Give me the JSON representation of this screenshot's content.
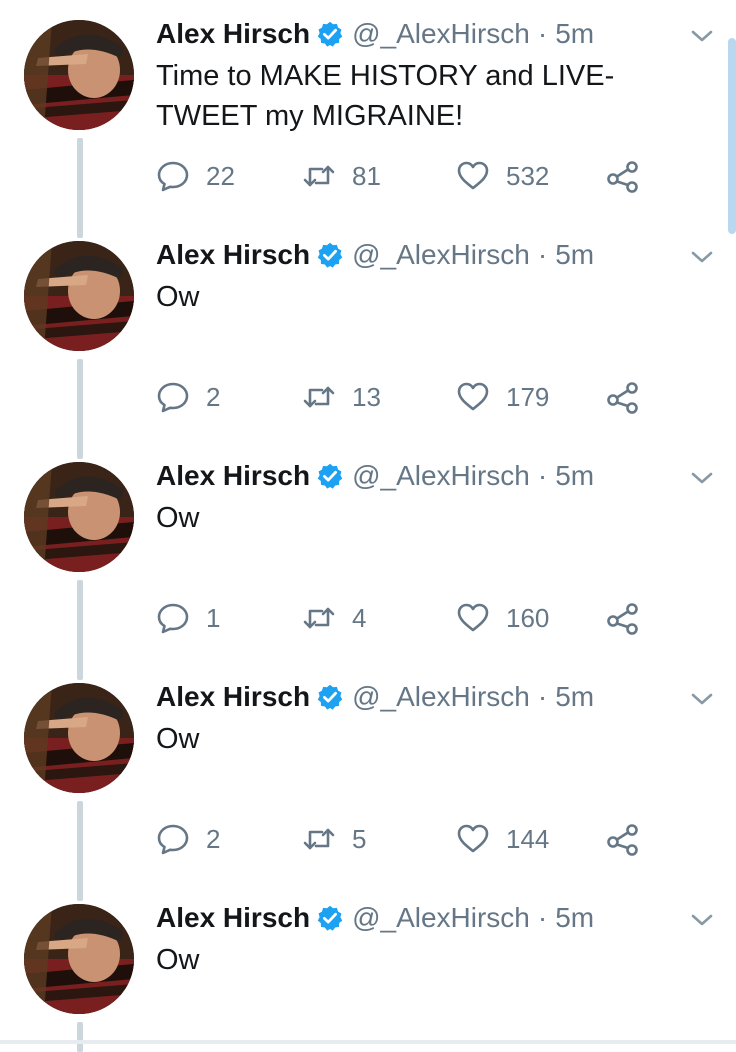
{
  "colors": {
    "text": "#14171a",
    "secondary": "#657786",
    "verified": "#1da1f2",
    "thread_line": "#ccd6dd",
    "scrollbar": "#b9d8ef"
  },
  "tweets": [
    {
      "name": "Alex Hirsch",
      "handle": "@_AlexHirsch",
      "dot": "·",
      "time": "5m",
      "text": "Time to MAKE HISTORY and LIVE-TWEET my MIGRAINE!",
      "replies": "22",
      "retweets": "81",
      "likes": "532"
    },
    {
      "name": "Alex Hirsch",
      "handle": "@_AlexHirsch",
      "dot": "·",
      "time": "5m",
      "text": "Ow",
      "replies": "2",
      "retweets": "13",
      "likes": "179"
    },
    {
      "name": "Alex Hirsch",
      "handle": "@_AlexHirsch",
      "dot": "·",
      "time": "5m",
      "text": "Ow",
      "replies": "1",
      "retweets": "4",
      "likes": "160"
    },
    {
      "name": "Alex Hirsch",
      "handle": "@_AlexHirsch",
      "dot": "·",
      "time": "5m",
      "text": "Ow",
      "replies": "2",
      "retweets": "5",
      "likes": "144"
    },
    {
      "name": "Alex Hirsch",
      "handle": "@_AlexHirsch",
      "dot": "·",
      "time": "5m",
      "text": "Ow"
    }
  ],
  "icons": {
    "verified": "verified-badge-icon",
    "caret": "chevron-down-icon",
    "reply": "reply-bubble-icon",
    "retweet": "retweet-icon",
    "like": "heart-icon",
    "share": "share-icon"
  }
}
